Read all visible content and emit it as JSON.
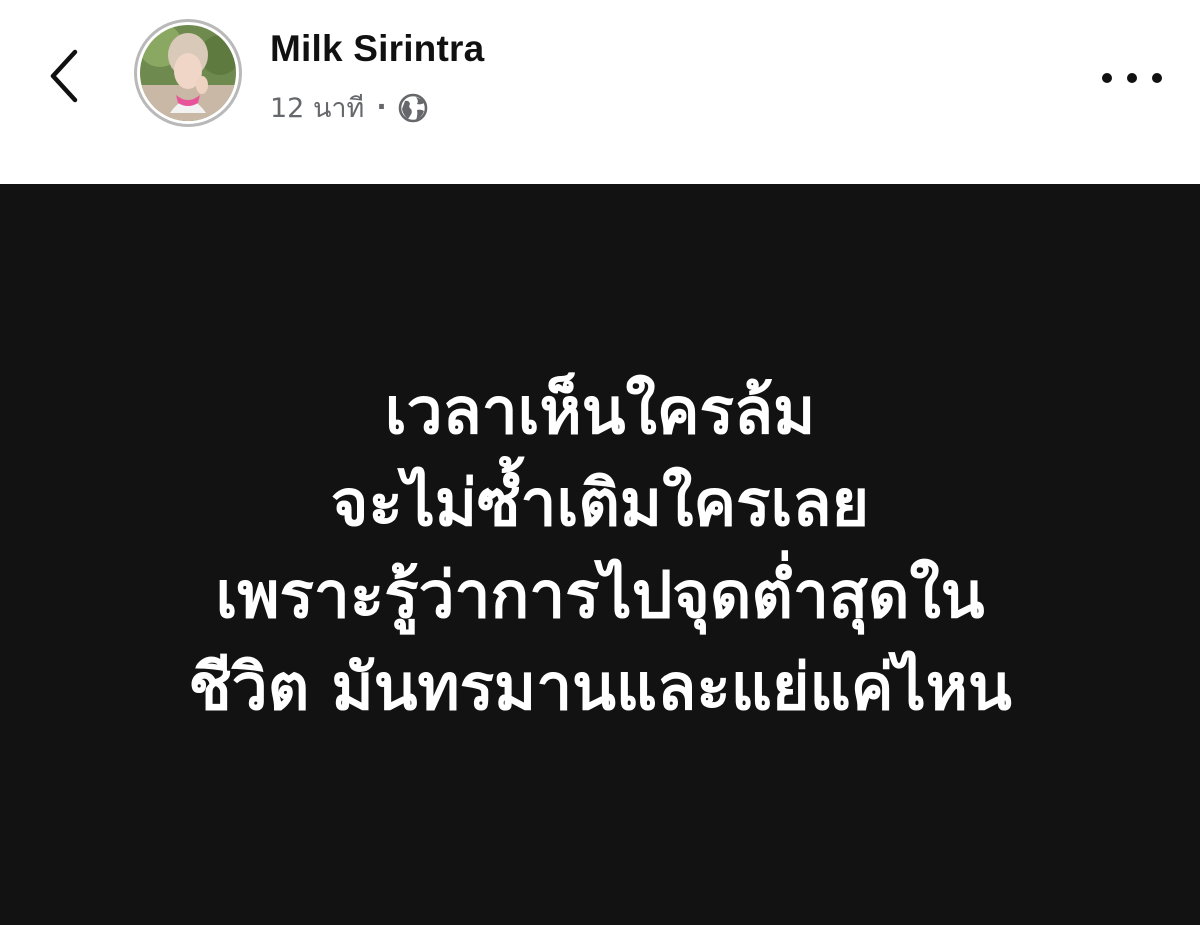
{
  "header": {
    "back_icon": "chevron-left-icon",
    "author_name": "Milk Sirintra",
    "timestamp": "12 นาที",
    "separator": "·",
    "privacy_icon": "globe-icon",
    "more_icon": "more-horizontal-icon"
  },
  "post": {
    "background_color": "#121212",
    "text_color": "#ffffff",
    "lines": [
      "เวลาเห็นใครล้ม",
      "จะไม่ซ้ำเติมใครเลย",
      "เพราะรู้ว่าการไปจุดต่ำสุดใน",
      "ชีวิต มันทรมานและแย่แค่ไหน"
    ]
  }
}
